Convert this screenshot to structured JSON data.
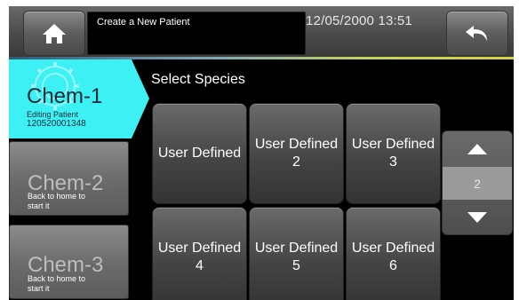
{
  "header": {
    "title": "Create a New Patient",
    "datetime": "12/05/2000 13:51"
  },
  "tabs": [
    {
      "name": "Chem-1",
      "sub1": "Editing Patient",
      "sub2": "120520001348"
    },
    {
      "name": "Chem-2",
      "sub1": "Back to home to",
      "sub2": "start it"
    },
    {
      "name": "Chem-3",
      "sub1": "Back to home to",
      "sub2": "start it"
    }
  ],
  "main": {
    "heading": "Select Species",
    "species": [
      {
        "line1": "User Defined",
        "line2": ""
      },
      {
        "line1": "User Defined",
        "line2": "2"
      },
      {
        "line1": "User Defined",
        "line2": "3"
      },
      {
        "line1": "User Defined",
        "line2": "4"
      },
      {
        "line1": "User Defined",
        "line2": "5"
      },
      {
        "line1": "User Defined",
        "line2": "6"
      }
    ]
  },
  "pager": {
    "page": "2"
  },
  "colors": {
    "active_tab": "#3cf0f3",
    "background": "#000000"
  },
  "icons": {
    "home": "home-icon",
    "back": "undo-arrow-icon",
    "up": "triangle-up-icon",
    "down": "triangle-down-icon"
  }
}
